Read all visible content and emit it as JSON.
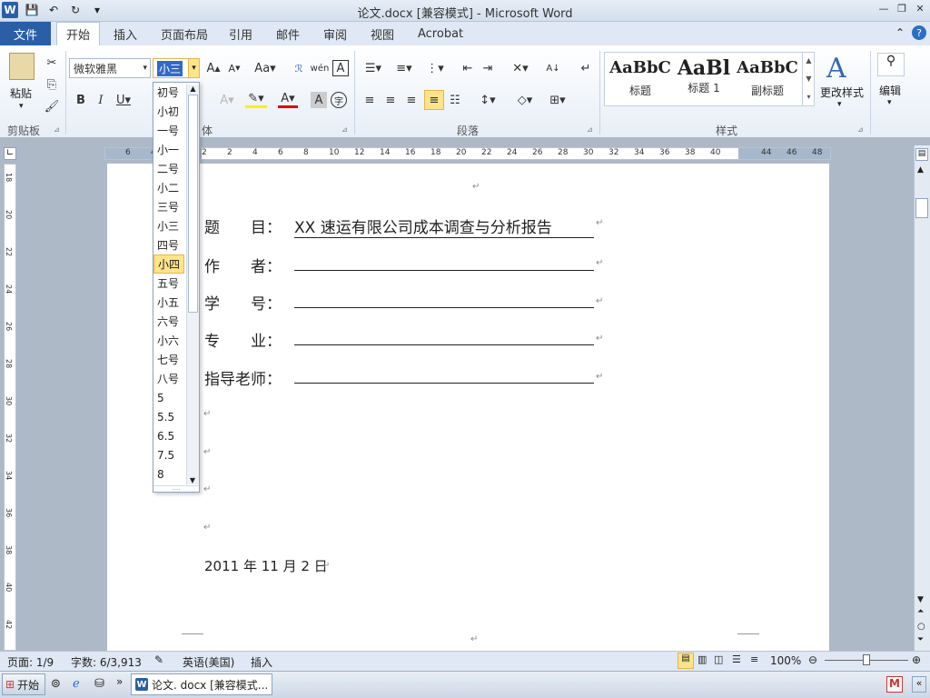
{
  "window": {
    "title": "论文.docx [兼容模式] - Microsoft Word"
  },
  "tabs": [
    "文件",
    "开始",
    "插入",
    "页面布局",
    "引用",
    "邮件",
    "审阅",
    "视图",
    "Acrobat"
  ],
  "ribbon": {
    "clipboard": {
      "paste": "粘贴",
      "label": "剪贴板"
    },
    "font": {
      "name": "微软雅黑",
      "size": "小三",
      "label": "体"
    },
    "paragraph": {
      "label": "段落"
    },
    "styles": {
      "label": "样式",
      "items": [
        {
          "preview": "AaBbC",
          "name": "标题"
        },
        {
          "preview": "AaBl",
          "name": "标题 1"
        },
        {
          "preview": "AaBbC",
          "name": "副标题"
        }
      ],
      "change": "更改样式"
    },
    "editing": {
      "label": "编辑"
    }
  },
  "ruler": {
    "marks": [
      "6",
      "4",
      "2",
      "2",
      "4",
      "6",
      "8",
      "10",
      "12",
      "14",
      "16",
      "18",
      "20",
      "22",
      "24",
      "26",
      "28",
      "30",
      "32",
      "34",
      "36",
      "38",
      "40",
      "44",
      "46",
      "48"
    ]
  },
  "vruler": {
    "marks": [
      "18",
      "20",
      "22",
      "24",
      "26",
      "28",
      "30",
      "32",
      "34",
      "36",
      "38",
      "40",
      "42"
    ]
  },
  "fontsize_dropdown": {
    "items": [
      "初号",
      "小初",
      "一号",
      "小一",
      "二号",
      "小二",
      "三号",
      "小三",
      "四号",
      "小四",
      "五号",
      "小五",
      "六号",
      "小六",
      "七号",
      "八号",
      "5",
      "5.5",
      "6.5",
      "7.5",
      "8"
    ],
    "selected": "小四"
  },
  "document": {
    "fields": [
      {
        "label": "题　　目：",
        "value": "XX 速运有限公司成本调查与分析报告"
      },
      {
        "label": "作　　者：",
        "value": ""
      },
      {
        "label": "学　　号：",
        "value": ""
      },
      {
        "label": "专　　业：",
        "value": ""
      },
      {
        "label": "指导老师：",
        "value": ""
      }
    ],
    "date": "2011 年 11 月 2 日",
    "para_mark": "↵"
  },
  "status": {
    "page": "页面: 1/9",
    "words": "字数: 6/3,913",
    "lang": "英语(美国)",
    "mode": "插入",
    "zoom": "100%"
  },
  "taskbar": {
    "start": "开始",
    "app": "论文. docx [兼容模式..."
  }
}
